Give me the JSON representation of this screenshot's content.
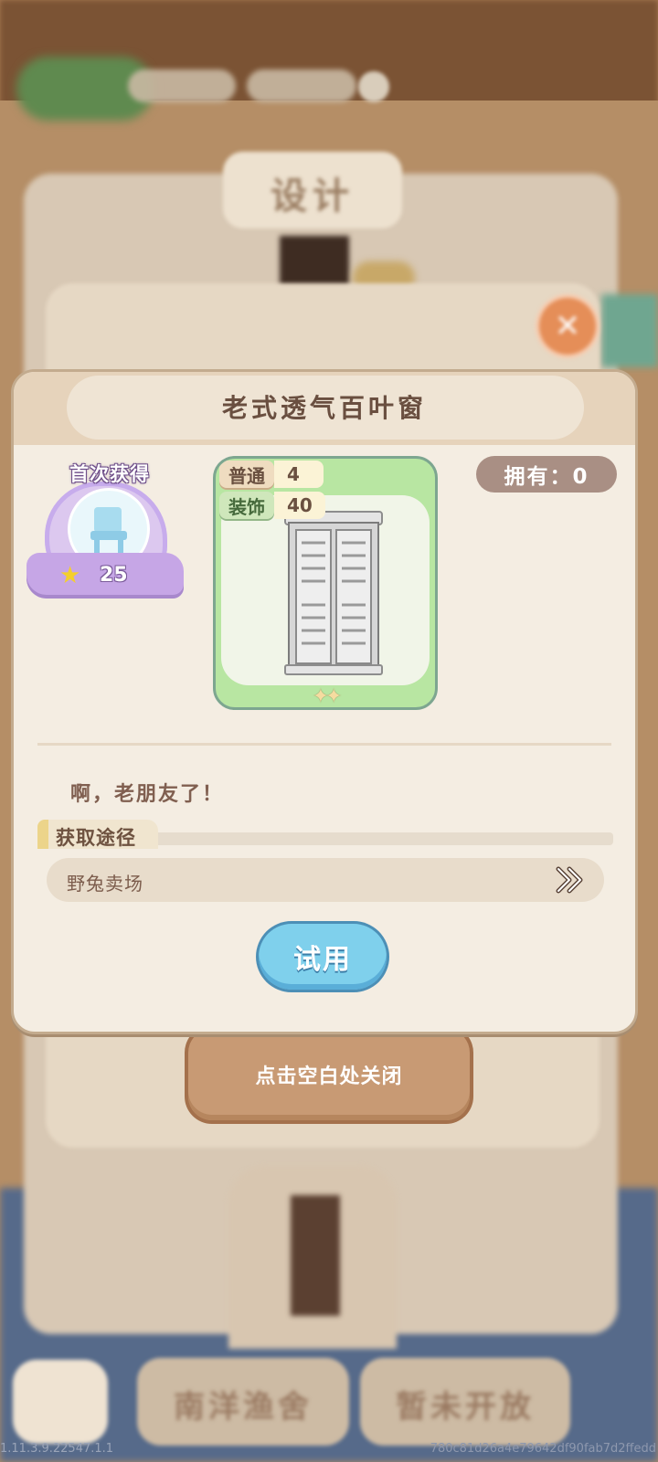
{
  "background": {
    "design_title": "设计",
    "bottom_tabs": [
      "南洋渔舍",
      "暂未开放"
    ]
  },
  "dialog": {
    "title": "老式透气百叶窗",
    "first_get": {
      "label": "首次获得",
      "reward_icon": "star-icon",
      "reward_count": "25",
      "preview_icon": "chair-icon"
    },
    "item_card": {
      "tags": [
        {
          "label": "普通",
          "value": "4"
        },
        {
          "label": "装饰",
          "value": "40"
        }
      ],
      "image": "louvered-window",
      "stars": "✦✦"
    },
    "owned": "拥有：0",
    "description": "啊，老朋友了！",
    "source_section": {
      "label": "获取途径",
      "items": [
        {
          "name": "野兔卖场",
          "icon": "double-chevron-right-icon"
        }
      ]
    },
    "try_button": "试用"
  },
  "close_hint": "点击空白处关闭",
  "footer": {
    "version": "1.11.3.9.22547.1.1",
    "hash": "780c81d26a4e79642df90fab7d2ffedd"
  },
  "colors": {
    "dialog_bg": "#f4ede2",
    "card_green": "#b8e6a2",
    "try_button": "#7fd0ec",
    "hint_button": "#c89a74"
  }
}
